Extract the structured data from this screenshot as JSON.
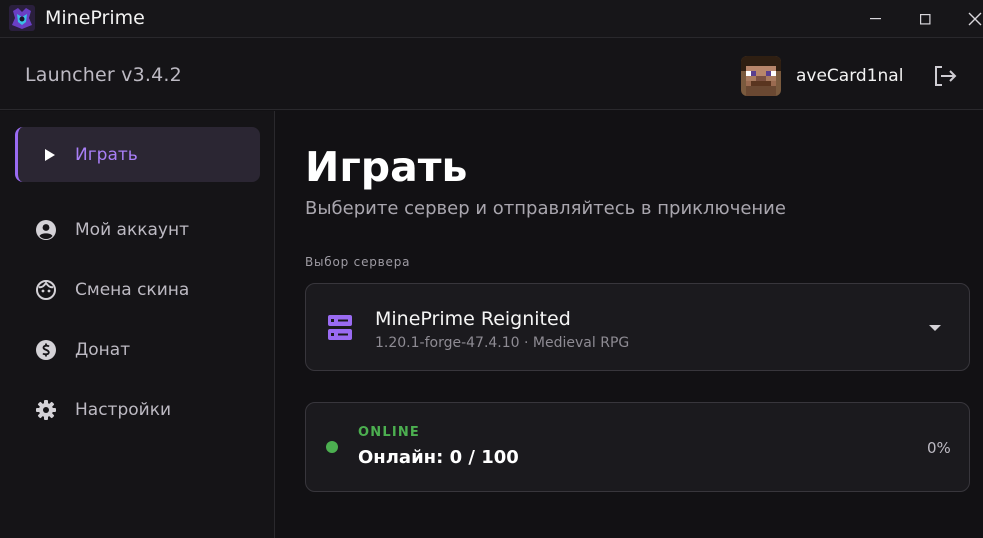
{
  "window": {
    "title": "MinePrime",
    "controls": {
      "minimize": "minimize-icon",
      "maximize": "maximize-icon",
      "close": "close-icon"
    }
  },
  "header": {
    "version_label": "Launcher v3.4.2",
    "username": "aveCard1nal"
  },
  "sidebar": {
    "items": [
      {
        "label": "Играть",
        "icon": "play-icon",
        "active": true
      },
      {
        "label": "Мой аккаунт",
        "icon": "account-icon",
        "active": false
      },
      {
        "label": "Смена скина",
        "icon": "skin-icon",
        "active": false
      },
      {
        "label": "Донат",
        "icon": "dollar-icon",
        "active": false
      },
      {
        "label": "Настройки",
        "icon": "gear-icon",
        "active": false
      }
    ]
  },
  "main": {
    "title": "Играть",
    "subtitle": "Выберите сервер и отправляйтесь в приключение",
    "server_section_label": "Выбор сервера",
    "selected_server": {
      "name": "MinePrime Reignited",
      "meta": "1.20.1-forge-47.4.10 · Medieval RPG"
    },
    "status": {
      "badge": "ONLINE",
      "online_text": "Онлайн: 0 / 100",
      "percent_text": "0%"
    }
  },
  "colors": {
    "accent": "#9a6bf2",
    "online": "#4caf50",
    "background": "#121114",
    "panel": "#151417"
  }
}
